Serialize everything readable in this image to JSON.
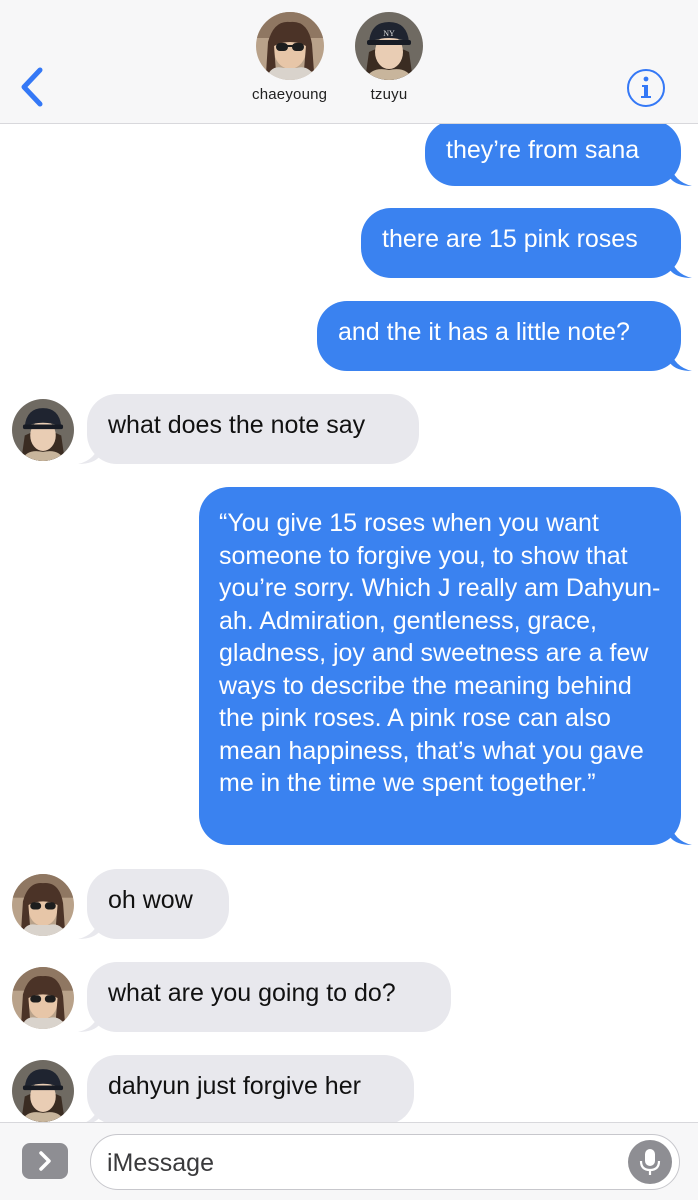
{
  "header": {
    "contacts": [
      {
        "name": "chaeyoung"
      },
      {
        "name": "tzuyu"
      }
    ]
  },
  "messages": [
    {
      "sender": "me",
      "text": "they’re from sana"
    },
    {
      "sender": "me",
      "text": "there are 15 pink roses"
    },
    {
      "sender": "me",
      "text": "and the it has a little note?"
    },
    {
      "sender": "tzuyu",
      "text": "what does the note say"
    },
    {
      "sender": "me",
      "text": "“You give 15 roses when you want someone to forgive you, to show that you’re sorry. Which J really am Dahyun-ah. Admiration, gentleness, grace, gladness, joy and sweetness are a few ways to describe the meaning behind the pink roses. A pink rose can also mean happiness, that’s what you gave me in the time we spent together.”"
    },
    {
      "sender": "chaeyoung",
      "text": "oh wow"
    },
    {
      "sender": "chaeyoung",
      "text": "what are you going to do?"
    },
    {
      "sender": "tzuyu",
      "text": "dahyun just forgive her"
    }
  ],
  "input": {
    "placeholder": "iMessage"
  },
  "colors": {
    "outgoing_bubble": "#3a82f0",
    "incoming_bubble": "#e8e8ed",
    "accent": "#3478f6"
  },
  "icons": [
    "back-chevron-icon",
    "info-icon",
    "expand-chevron-icon",
    "microphone-icon"
  ]
}
